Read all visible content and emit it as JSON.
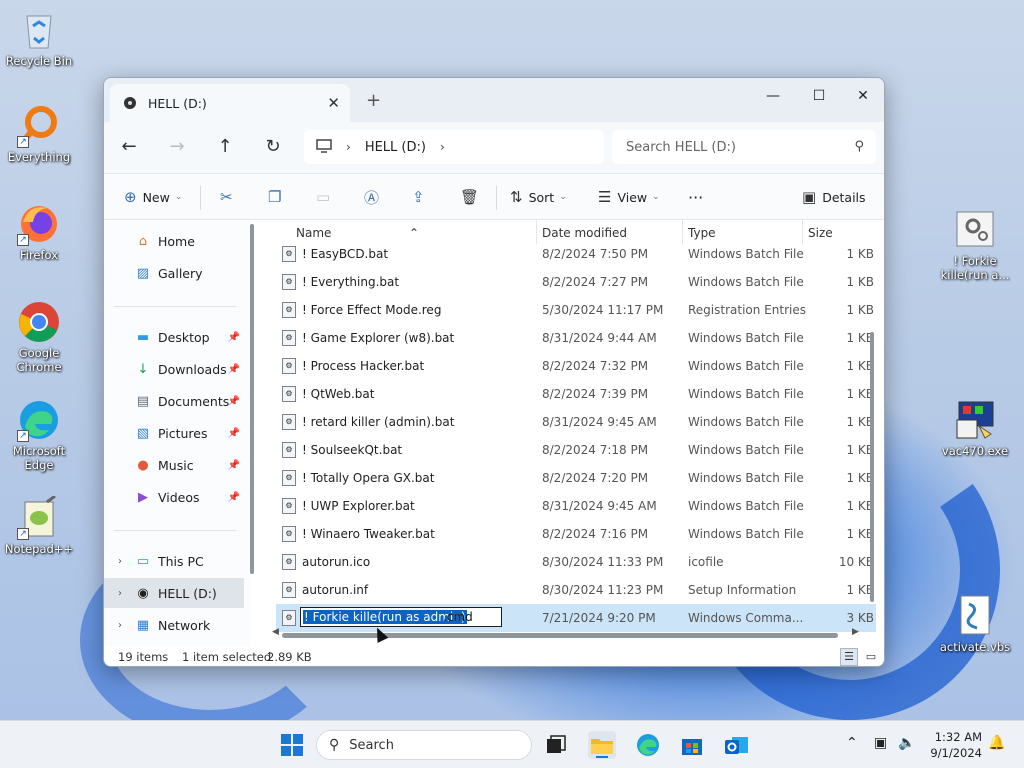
{
  "desktop": {
    "icons": [
      {
        "label": "Recycle Bin"
      },
      {
        "label": "Everything"
      },
      {
        "label": "Firefox"
      },
      {
        "label": "Google Chrome"
      },
      {
        "label": "Microsoft Edge"
      },
      {
        "label": "Notepad++"
      },
      {
        "label": "! Forkie kille(run a..."
      },
      {
        "label": "vac470.exe"
      },
      {
        "label": "activate.vbs"
      }
    ]
  },
  "window": {
    "tab_title": "HELL (D:)",
    "tab_close": "✕",
    "new_tab": "+",
    "minimize": "—",
    "maximize": "☐",
    "close": "✕",
    "nav": {
      "back": "←",
      "forward": "→",
      "up": "↑",
      "refresh": "↻"
    },
    "breadcrumb": [
      "HELL (D:)"
    ],
    "search_placeholder": "Search HELL (D:)",
    "toolbar": {
      "new": "New",
      "sort": "Sort",
      "view": "View",
      "more": "···",
      "details": "Details"
    },
    "sidebar": {
      "items": [
        {
          "label": "Home"
        },
        {
          "label": "Gallery"
        },
        {
          "label": "Desktop"
        },
        {
          "label": "Downloads"
        },
        {
          "label": "Documents"
        },
        {
          "label": "Pictures"
        },
        {
          "label": "Music"
        },
        {
          "label": "Videos"
        },
        {
          "label": "This PC"
        },
        {
          "label": "HELL (D:)"
        },
        {
          "label": "Network"
        }
      ]
    },
    "columns": {
      "name": "Name",
      "date": "Date modified",
      "type": "Type",
      "size": "Size"
    },
    "files": [
      {
        "name": "! EasyBCD.bat",
        "date": "8/2/2024 7:50 PM",
        "type": "Windows Batch File",
        "size": "1 KB"
      },
      {
        "name": "! Everything.bat",
        "date": "8/2/2024 7:27 PM",
        "type": "Windows Batch File",
        "size": "1 KB"
      },
      {
        "name": "! Force Effect Mode.reg",
        "date": "5/30/2024 11:17 PM",
        "type": "Registration Entries",
        "size": "1 KB"
      },
      {
        "name": "! Game Explorer (w8).bat",
        "date": "8/31/2024 9:44 AM",
        "type": "Windows Batch File",
        "size": "1 KB"
      },
      {
        "name": "! Process Hacker.bat",
        "date": "8/2/2024 7:32 PM",
        "type": "Windows Batch File",
        "size": "1 KB"
      },
      {
        "name": "! QtWeb.bat",
        "date": "8/2/2024 7:39 PM",
        "type": "Windows Batch File",
        "size": "1 KB"
      },
      {
        "name": "! retard killer (admin).bat",
        "date": "8/31/2024 9:45 AM",
        "type": "Windows Batch File",
        "size": "1 KB"
      },
      {
        "name": "! SoulseekQt.bat",
        "date": "8/2/2024 7:18 PM",
        "type": "Windows Batch File",
        "size": "1 KB"
      },
      {
        "name": "! Totally Opera GX.bat",
        "date": "8/2/2024 7:20 PM",
        "type": "Windows Batch File",
        "size": "1 KB"
      },
      {
        "name": "! UWP Explorer.bat",
        "date": "8/31/2024 9:45 AM",
        "type": "Windows Batch File",
        "size": "1 KB"
      },
      {
        "name": "! Winaero Tweaker.bat",
        "date": "8/2/2024 7:16 PM",
        "type": "Windows Batch File",
        "size": "1 KB"
      },
      {
        "name": "autorun.ico",
        "date": "8/30/2024 11:33 PM",
        "type": "icofile",
        "size": "10 KB"
      },
      {
        "name": "autorun.inf",
        "date": "8/30/2024 11:23 PM",
        "type": "Setup Information",
        "size": "1 KB"
      }
    ],
    "rename_row": {
      "selected_text": "! Forkie kille(run as admin)",
      "extension": ".cmd",
      "date": "7/21/2024 9:20 PM",
      "type": "Windows Comma...",
      "size": "3 KB"
    },
    "status": {
      "count": "19 items",
      "selected": "1 item selected",
      "size": "2.89 KB"
    }
  },
  "taskbar": {
    "search_label": "Search",
    "time": "1:32 AM",
    "date": "9/1/2024"
  },
  "colors": {
    "accent": "#0a64c8",
    "selection": "#cce4f7"
  }
}
